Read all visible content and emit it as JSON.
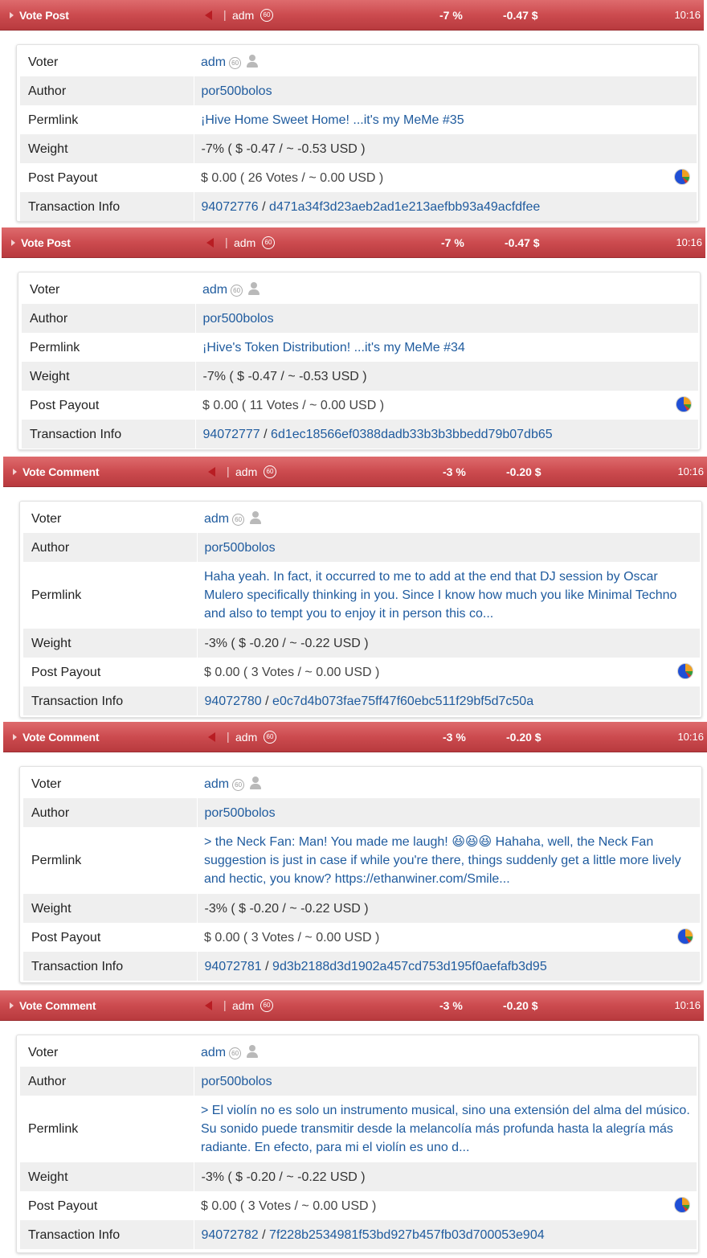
{
  "labels": {
    "voter": "Voter",
    "author": "Author",
    "permlink": "Permlink",
    "weight": "Weight",
    "post_payout": "Post Payout",
    "transaction_info": "Transaction Info",
    "separator": "|",
    "tx_separator": "/"
  },
  "colors": {
    "bar": "#cc4b4f",
    "link": "#1f5b9e"
  },
  "entries": [
    {
      "type": "Vote Post",
      "account": "adm",
      "reputation": "60",
      "percent": "-7 %",
      "value": "-0.47 $",
      "time": "10:16",
      "voter": "adm",
      "author": "por500bolos",
      "permlink": "¡Hive Home Sweet Home! ...it's my MeMe #35",
      "weight": "-7% ( $ -0.47 / ~ -0.53 USD )",
      "payout": "$ 0.00 ( 26 Votes / ~ 0.00 USD )",
      "block": "94072776",
      "tx": "d471a34f3d23aeb2ad1e213aefbb93a49acfdfee"
    },
    {
      "type": "Vote Post",
      "account": "adm",
      "reputation": "60",
      "percent": "-7 %",
      "value": "-0.47 $",
      "time": "10:16",
      "voter": "adm",
      "author": "por500bolos",
      "permlink": "¡Hive's Token Distribution! ...it's my MeMe #34",
      "weight": "-7% ( $ -0.47 / ~ -0.53 USD )",
      "payout": "$ 0.00 ( 11 Votes / ~ 0.00 USD )",
      "block": "94072777",
      "tx": "6d1ec18566ef0388dadb33b3b3bbedd79b07db65"
    },
    {
      "type": "Vote Comment",
      "account": "adm",
      "reputation": "60",
      "percent": "-3 %",
      "value": "-0.20 $",
      "time": "10:16",
      "voter": "adm",
      "author": "por500bolos",
      "permlink": "Haha yeah. In fact, it occurred to me to add at the end that DJ session by Oscar Mulero specifically thinking in you. Since I know how much you like Minimal Techno and also to tempt you to enjoy it in person this co...",
      "weight": "-3% ( $ -0.20 / ~ -0.22 USD )",
      "payout": "$ 0.00 ( 3 Votes / ~ 0.00 USD )",
      "block": "94072780",
      "tx": "e0c7d4b073fae75ff47f60ebc511f29bf5d7c50a"
    },
    {
      "type": "Vote Comment",
      "account": "adm",
      "reputation": "60",
      "percent": "-3 %",
      "value": "-0.20 $",
      "time": "10:16",
      "voter": "adm",
      "author": "por500bolos",
      "permlink": "> the Neck Fan: Man! You made me laugh! 😆😆😆 Hahaha, well, the Neck Fan suggestion is just in case if while you're there, things suddenly get a little more lively and hectic, you know? https://ethanwiner.com/Smile...",
      "weight": "-3% ( $ -0.20 / ~ -0.22 USD )",
      "payout": "$ 0.00 ( 3 Votes / ~ 0.00 USD )",
      "block": "94072781",
      "tx": "9d3b2188d3d1902a457cd753d195f0aefafb3d95"
    },
    {
      "type": "Vote Comment",
      "account": "adm",
      "reputation": "60",
      "percent": "-3 %",
      "value": "-0.20 $",
      "time": "10:16",
      "voter": "adm",
      "author": "por500bolos",
      "permlink": "> El violín no es solo un instrumento musical, sino una extensión del alma del músico. Su sonido puede transmitir desde la melancolía más profunda hasta la alegría más radiante. En efecto, para mi el violín es uno d...",
      "weight": "-3% ( $ -0.20 / ~ -0.22 USD )",
      "payout": "$ 0.00 ( 3 Votes / ~ 0.00 USD )",
      "block": "94072782",
      "tx": "7f228b2534981f53bd927b457fb03d700053e904"
    }
  ]
}
